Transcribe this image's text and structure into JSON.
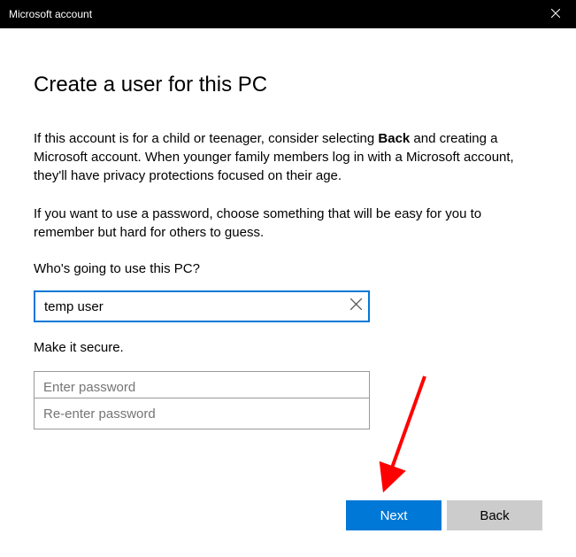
{
  "titlebar": {
    "title": "Microsoft account"
  },
  "page": {
    "heading": "Create a user for this PC",
    "intro1_pre": "If this account is for a child or teenager, consider selecting ",
    "intro1_bold": "Back",
    "intro1_post": " and creating a Microsoft account. When younger family members log in with a Microsoft account, they'll have privacy protections focused on their age.",
    "intro2": "If you want to use a password, choose something that will be easy for you to remember but hard for others to guess."
  },
  "fields": {
    "who_label": "Who's going to use this PC?",
    "username_value": "temp user",
    "secure_label": "Make it secure.",
    "password_placeholder": "Enter password",
    "password2_placeholder": "Re-enter password"
  },
  "buttons": {
    "next": "Next",
    "back": "Back"
  },
  "colors": {
    "accent": "#0078d7"
  }
}
